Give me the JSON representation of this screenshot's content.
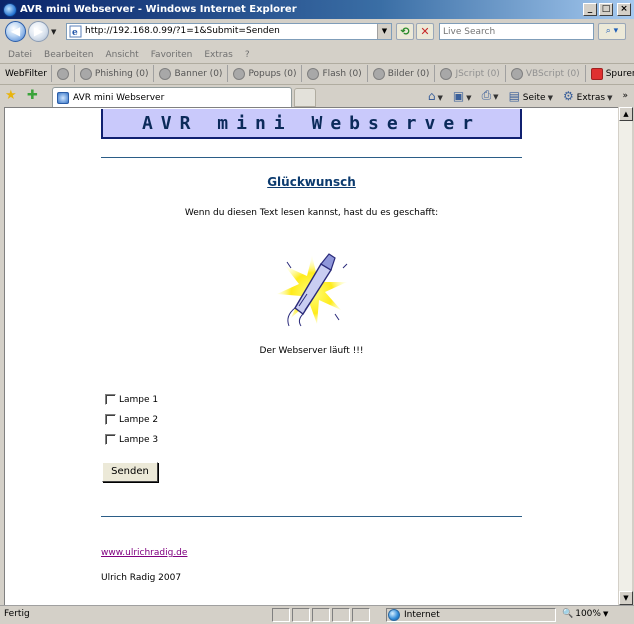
{
  "window": {
    "title": "AVR mini Webserver - Windows Internet Explorer",
    "buttons": {
      "minimize": "_",
      "maximize": "□",
      "close": "×"
    }
  },
  "addressbar": {
    "url": "http://192.168.0.99/?1=1&Submit=Senden",
    "search_placeholder": "Live Search"
  },
  "menu": {
    "items": [
      "Datei",
      "Bearbeiten",
      "Ansicht",
      "Favoriten",
      "Extras",
      "?"
    ]
  },
  "webfilter": {
    "label": "WebFilter",
    "items": [
      {
        "label": "Phishing (0)",
        "icon": "phishing-icon"
      },
      {
        "label": "Banner (0)",
        "icon": "banner-icon"
      },
      {
        "label": "Popups (0)",
        "icon": "popup-icon"
      },
      {
        "label": "Flash (0)",
        "icon": "flash-icon"
      },
      {
        "label": "Bilder (0)",
        "icon": "image-icon"
      },
      {
        "label": "JScript (0)",
        "icon": "jscript-icon"
      },
      {
        "label": "VBScript (0)",
        "icon": "vbscript-icon"
      },
      {
        "label": "Spurenl",
        "icon": "trace-icon"
      }
    ]
  },
  "tabs": {
    "active": "AVR mini Webserver",
    "commands": {
      "page": "Seite",
      "tools": "Extras"
    }
  },
  "page": {
    "banner": "AVR mini Webserver",
    "heading": "Glückwunsch",
    "intro": "Wenn du diesen Text lesen kannst, hast du es geschafft:",
    "status": "Der Webserver läuft !!!",
    "checkboxes": [
      {
        "label": "Lampe 1",
        "checked": false
      },
      {
        "label": "Lampe 2",
        "checked": false
      },
      {
        "label": "Lampe 3",
        "checked": false
      }
    ],
    "submit_label": "Senden",
    "link": "www.ulrichradig.de",
    "author": "Ulrich Radig 2007"
  },
  "statusbar": {
    "status": "Fertig",
    "zone": "Internet",
    "zoom": "100%"
  },
  "colors": {
    "banner_bg": "#c9c9fb",
    "banner_text": "#0b2a5a",
    "link_visited": "#800080",
    "rule": "#2b5d87"
  }
}
